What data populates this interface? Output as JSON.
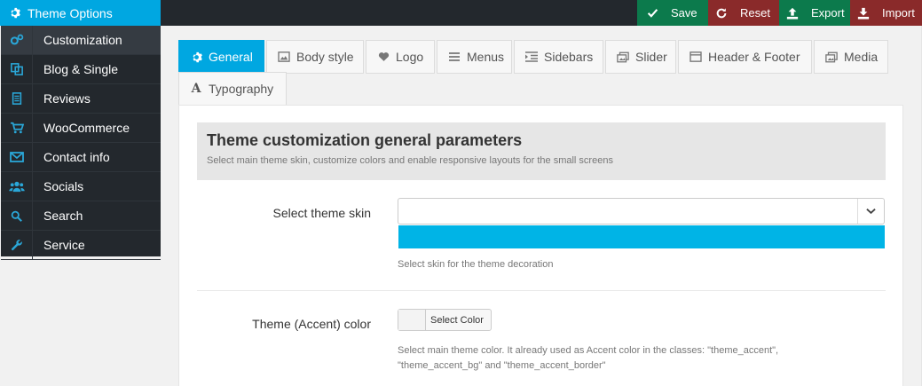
{
  "brand": {
    "label": "Theme Options",
    "icon": "gear-icon"
  },
  "actions": [
    {
      "label": "Save",
      "icon": "check-icon",
      "color": "#0c7a4c"
    },
    {
      "label": "Reset",
      "icon": "refresh-icon",
      "color": "#8a2a2a"
    },
    {
      "label": "Export",
      "icon": "upload-icon",
      "color": "#0c7a4c"
    },
    {
      "label": "Import",
      "icon": "download-icon",
      "color": "#8a2a2a"
    }
  ],
  "sidebar": {
    "items": [
      {
        "label": "Customization",
        "icon": "gears-icon",
        "active": true
      },
      {
        "label": "Blog & Single",
        "icon": "copy-icon"
      },
      {
        "label": "Reviews",
        "icon": "document-icon"
      },
      {
        "label": "WooCommerce",
        "icon": "cart-icon"
      },
      {
        "label": "Contact info",
        "icon": "envelope-icon"
      },
      {
        "label": "Socials",
        "icon": "users-icon"
      },
      {
        "label": "Search",
        "icon": "search-icon"
      },
      {
        "label": "Service",
        "icon": "wrench-icon"
      }
    ]
  },
  "tabs": [
    {
      "label": "General",
      "icon": "gear-icon",
      "active": true
    },
    {
      "label": "Body style",
      "icon": "image-icon"
    },
    {
      "label": "Logo",
      "icon": "heart-icon"
    },
    {
      "label": "Menus",
      "icon": "menu-icon"
    },
    {
      "label": "Sidebars",
      "icon": "indent-icon"
    },
    {
      "label": "Slider",
      "icon": "images-icon"
    },
    {
      "label": "Header & Footer",
      "icon": "window-icon"
    },
    {
      "label": "Media",
      "icon": "images-icon"
    },
    {
      "label": "Typography",
      "icon": "font-icon"
    }
  ],
  "section": {
    "title": "Theme customization general parameters",
    "description": "Select main theme skin, customize colors and enable responsive layouts for the small screens"
  },
  "fields": {
    "skin": {
      "label": "Select theme skin",
      "value": "",
      "preview_color": "#00b4e6",
      "help": "Select skin for the theme decoration"
    },
    "accent": {
      "label": "Theme (Accent) color",
      "button_label": "Select Color",
      "help_line1": "Select main theme color. It already used as Accent color in the classes: \"theme_accent\",",
      "help_line2": "\"theme_accent_bg\" and \"theme_accent_border\""
    }
  },
  "colors": {
    "accent": "#00a7e1",
    "dark": "#23282d"
  }
}
